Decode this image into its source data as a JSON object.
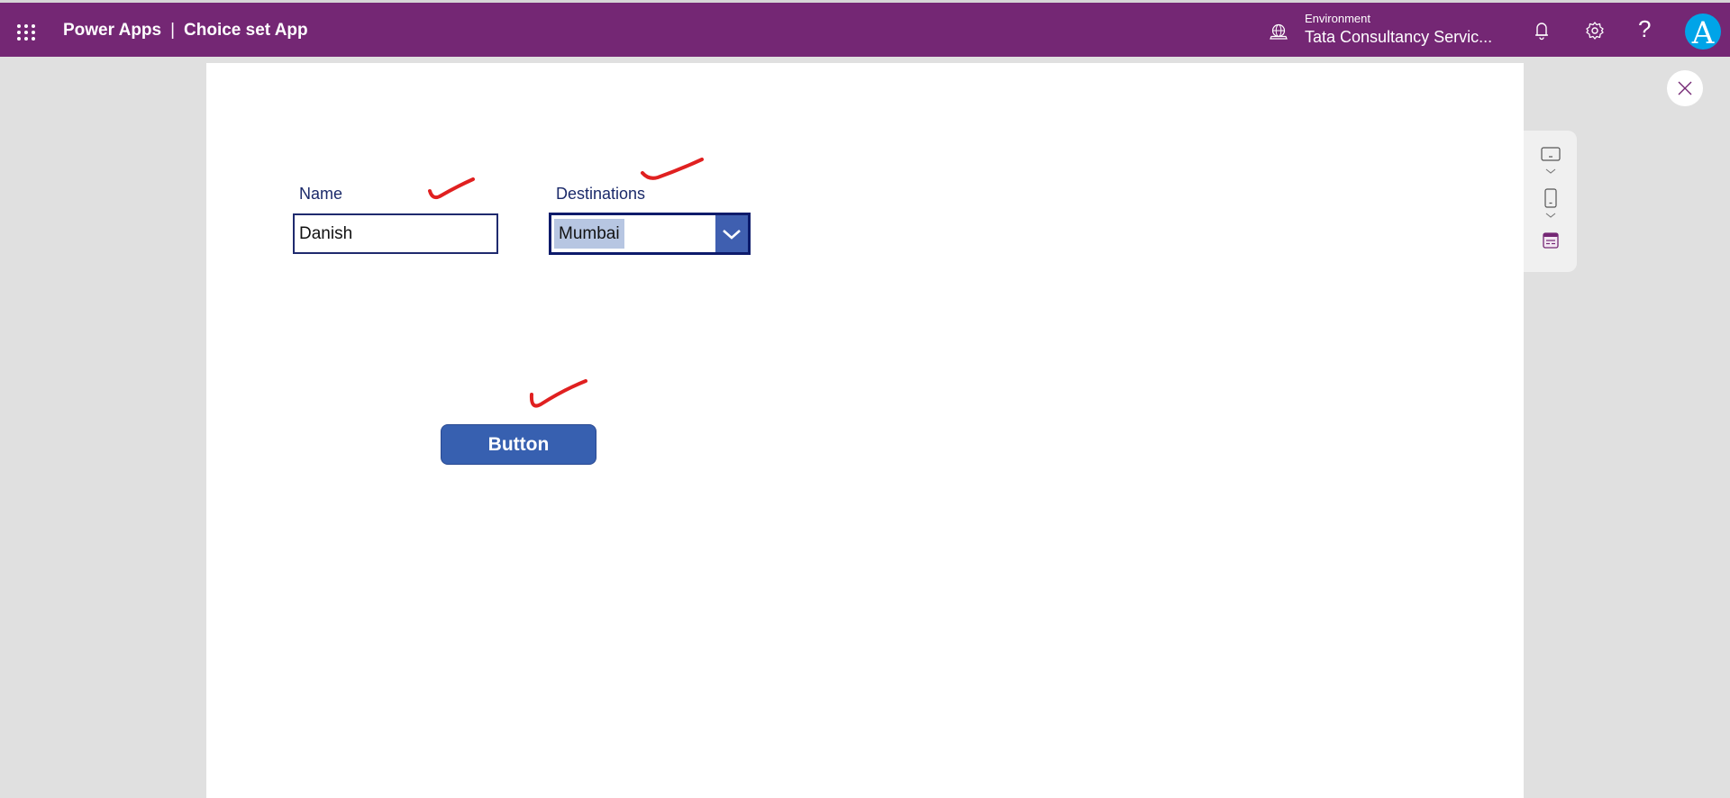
{
  "header": {
    "app_name": "Power Apps",
    "separator": "|",
    "app_title": "Choice set App",
    "environment_label": "Environment",
    "environment_value": "Tata Consultancy Servic...",
    "help_glyph": "?",
    "avatar_initial": "A",
    "icons": [
      "waffle-icon",
      "environment-globe-icon",
      "bell-icon",
      "gear-icon",
      "help-icon",
      "avatar"
    ],
    "colors": {
      "bar": "#742774",
      "avatar": "#00a4e8"
    }
  },
  "form": {
    "name_label": "Name",
    "name_value": "Danish",
    "destinations_label": "Destinations",
    "destinations_selected": "Mumbai",
    "button_label": "Button",
    "colors": {
      "label": "#1b2a6a",
      "button": "#3760b0",
      "dropdown_border": "#0d1b6b",
      "selection": "#b7c6e2"
    }
  },
  "side_panel": {
    "items": [
      "tablet-layout-icon",
      "phone-layout-icon",
      "app-settings-icon"
    ]
  },
  "annotations": {
    "checkmarks": 3,
    "color": "#e02020"
  }
}
